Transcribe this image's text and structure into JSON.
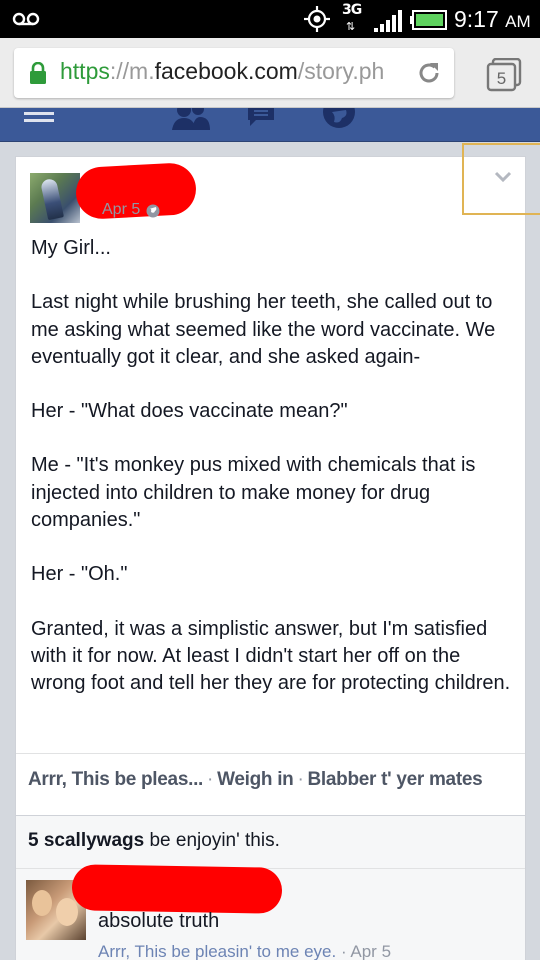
{
  "status_bar": {
    "network": "3G",
    "time": "9:17",
    "ampm": "AM",
    "icons": [
      "voicemail-icon",
      "gps-icon",
      "signal-icon",
      "battery-icon"
    ]
  },
  "browser": {
    "url_scheme": "https",
    "url_sep": "://",
    "url_sub": "m.",
    "url_domain": "facebook.com",
    "url_path": "/story.ph",
    "tab_count": "5"
  },
  "nav": {
    "icons": [
      "menu-icon",
      "friends-icon",
      "messages-icon",
      "globe-icon"
    ]
  },
  "post": {
    "date": "Apr 5",
    "paragraphs": [
      "My Girl...",
      "Last night while brushing her teeth, she called out to me asking what seemed like the word vaccinate. We eventually got it clear, and she asked again-",
      "Her - \"What does vaccinate mean?\"",
      "Me - \"It's monkey pus mixed with chemicals that is injected into children to make money for drug companies.\"",
      "Her - \"Oh.\"",
      "Granted, it was a simplistic answer, but I'm satisfied with it for now. At least I didn't start her off on the wrong foot and tell her they are for protecting children."
    ],
    "actions": {
      "like": "Arrr, This be pleas...",
      "sep": "·",
      "comment": "Weigh in",
      "share": "Blabber t' yer mates"
    }
  },
  "likes": {
    "count_text": "5 scallywags",
    "suffix": " be enjoyin' this."
  },
  "comment": {
    "text": "absolute truth",
    "like_label": "Arrr, This be pleasin' to me eye.",
    "sep": " · ",
    "time": "Apr 5"
  },
  "colors": {
    "facebook_blue": "#3b5998",
    "https_green": "#2e9b3a",
    "redaction_red": "#ff0000",
    "options_highlight": "#e0b454"
  }
}
